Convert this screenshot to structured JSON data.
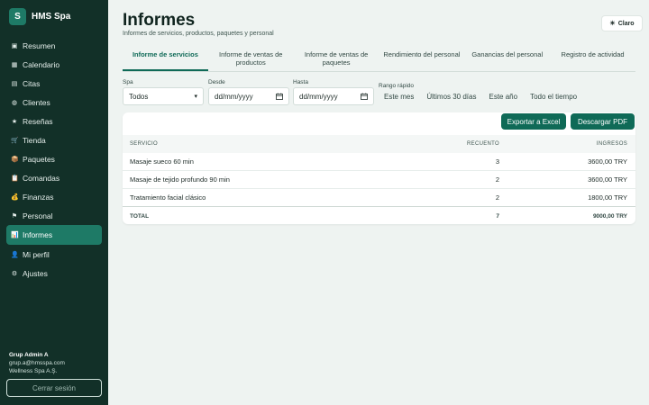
{
  "app": {
    "logo_letter": "S",
    "name": "HMS Spa"
  },
  "sidebar": {
    "items": [
      {
        "label": "Resumen",
        "icon": "▣"
      },
      {
        "label": "Calendario",
        "icon": "▦"
      },
      {
        "label": "Citas",
        "icon": "▤"
      },
      {
        "label": "Clientes",
        "icon": "◍"
      },
      {
        "label": "Reseñas",
        "icon": "★"
      },
      {
        "label": "Tienda",
        "icon": "🛒"
      },
      {
        "label": "Paquetes",
        "icon": "📦"
      },
      {
        "label": "Comandas",
        "icon": "📋"
      },
      {
        "label": "Finanzas",
        "icon": "💰"
      },
      {
        "label": "Personal",
        "icon": "⚑"
      },
      {
        "label": "Informes",
        "icon": "📊"
      },
      {
        "label": "Mi perfil",
        "icon": "👤"
      },
      {
        "label": "Ajustes",
        "icon": "⚙"
      }
    ],
    "user": {
      "name": "Grup Admin A",
      "email": "grup.a@hmsspa.com",
      "org": "Wellness Spa A.Ş."
    },
    "logout_label": "Cerrar sesión"
  },
  "header": {
    "title": "Informes",
    "subtitle": "Informes de servicios, productos, paquetes y personal",
    "theme_label": "Claro",
    "theme_icon": "☀"
  },
  "tabs": [
    {
      "label": "Informe de servicios"
    },
    {
      "label": "Informe de ventas de productos"
    },
    {
      "label": "Informe de ventas de paquetes"
    },
    {
      "label": "Rendimiento del personal"
    },
    {
      "label": "Ganancias del personal"
    },
    {
      "label": "Registro de actividad"
    }
  ],
  "filters": {
    "spa_label": "Spa",
    "spa_value": "Todos",
    "from_label": "Desde",
    "from_placeholder": "dd/mm/yyyy",
    "to_label": "Hasta",
    "to_placeholder": "dd/mm/yyyy",
    "quick_label": "Rango rápido",
    "quick_options": [
      "Este mes",
      "Últimos 30 días",
      "Este año",
      "Todo el tiempo"
    ]
  },
  "actions": {
    "export_excel": "Exportar a Excel",
    "download_pdf": "Descargar PDF"
  },
  "table": {
    "headers": {
      "service": "SERVICIO",
      "count": "RECUENTO",
      "income": "INGRESOS"
    },
    "rows": [
      {
        "service": "Masaje sueco 60 min",
        "count": "3",
        "income": "3600,00 TRY"
      },
      {
        "service": "Masaje de tejido profundo 90 min",
        "count": "2",
        "income": "3600,00 TRY"
      },
      {
        "service": "Tratamiento facial clásico",
        "count": "2",
        "income": "1800,00 TRY"
      }
    ],
    "total": {
      "label": "TOTAL",
      "count": "7",
      "income": "9000,00 TRY"
    }
  },
  "colors": {
    "sidebar_bg": "#123028",
    "accent": "#0f6a57",
    "page_bg": "#eef3f1"
  }
}
